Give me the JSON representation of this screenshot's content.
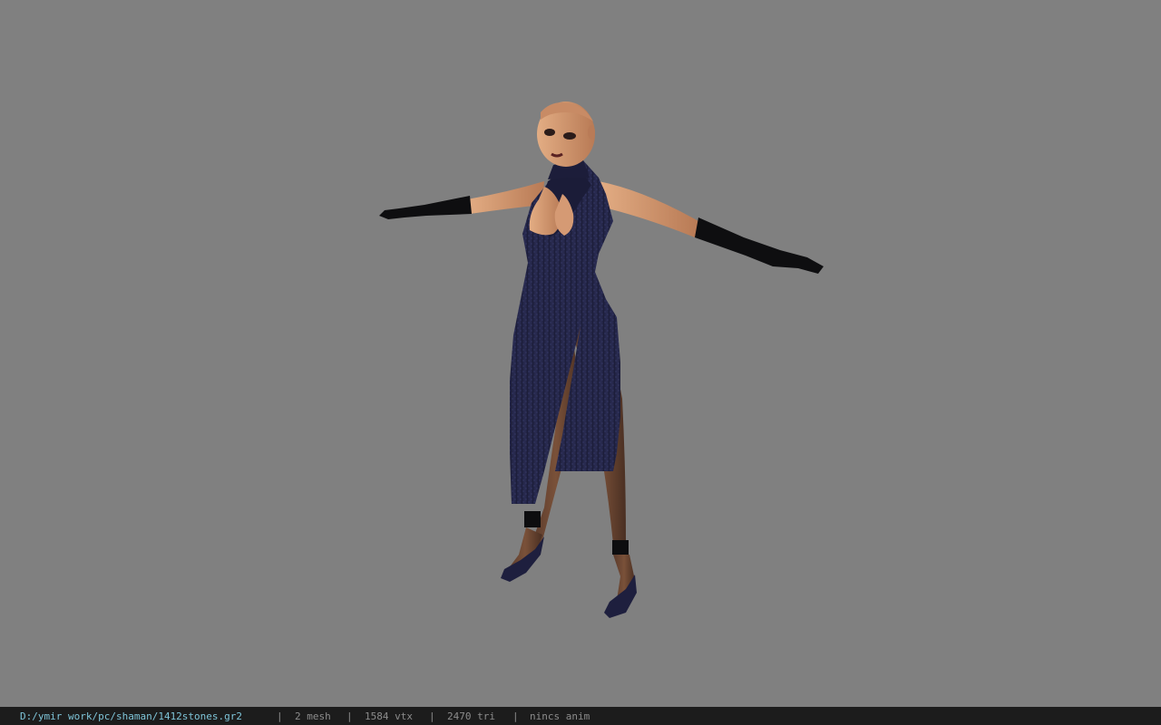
{
  "viewport": {
    "background_color": "#808080",
    "model_description_icon": "character-model"
  },
  "status_bar": {
    "file_path": "D:/ymir work/pc/shaman/1412stones.gr2",
    "mesh_count": "2 mesh",
    "vertex_count": "1584 vtx",
    "triangle_count": "2470 tri",
    "animation": "nincs anim",
    "separator": "|"
  },
  "colors": {
    "status_bar_bg": "#1c1c1c",
    "path_color": "#7ec4d8",
    "stat_color": "#8c8c8c",
    "dress_color": "#1e1f3e",
    "skin_color": "#d59a74",
    "glove_color": "#0d0d0f"
  }
}
